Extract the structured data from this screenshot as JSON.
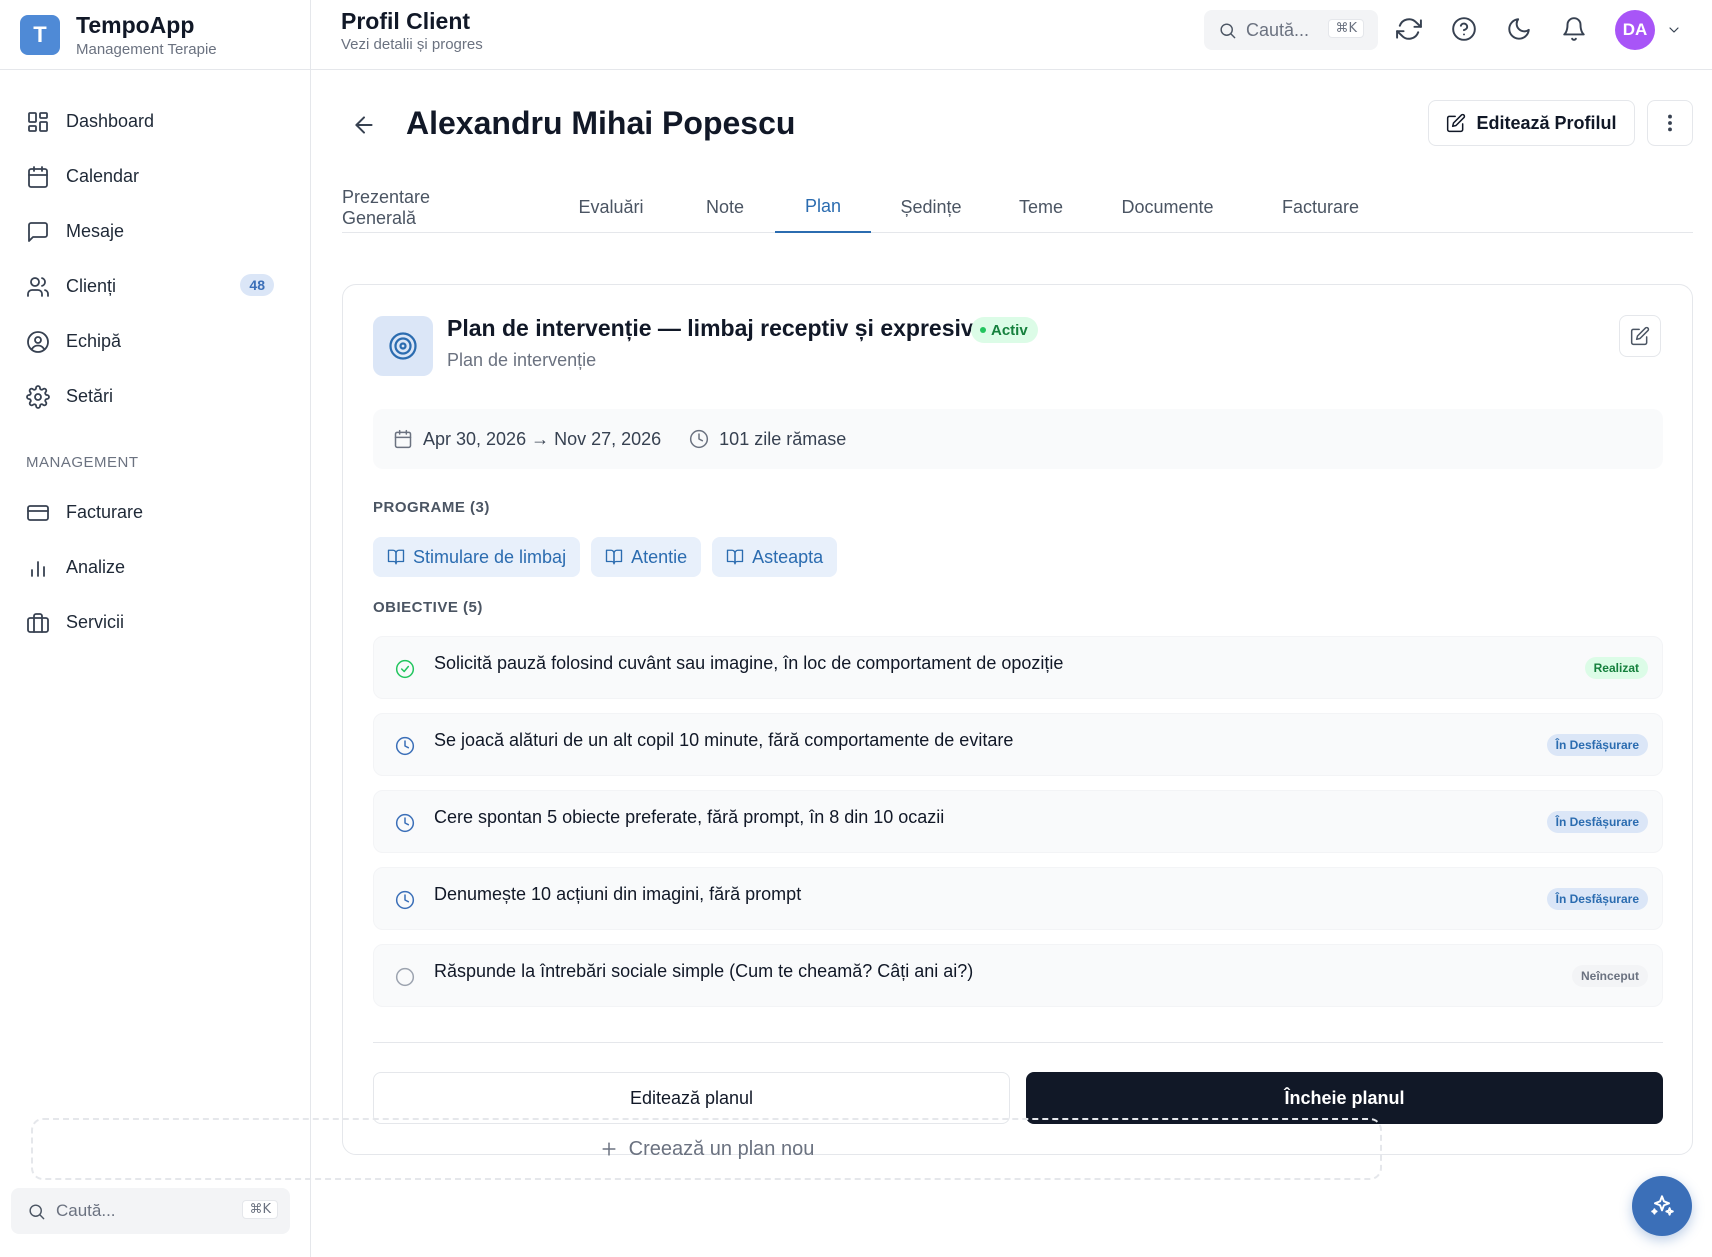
{
  "brand": {
    "logo_letter": "T",
    "name": "TempoApp",
    "subtitle": "Management Terapie"
  },
  "sidebar": {
    "items": [
      {
        "label": "Dashboard",
        "icon": "dashboard-icon"
      },
      {
        "label": "Calendar",
        "icon": "calendar-icon"
      },
      {
        "label": "Mesaje",
        "icon": "message-icon"
      },
      {
        "label": "Clienți",
        "icon": "users-icon",
        "badge": "48"
      },
      {
        "label": "Echipă",
        "icon": "user-circle-icon"
      },
      {
        "label": "Setări",
        "icon": "gear-icon"
      }
    ],
    "section_label": "MANAGEMENT",
    "management_items": [
      {
        "label": "Facturare",
        "icon": "credit-card-icon"
      },
      {
        "label": "Analize",
        "icon": "bar-chart-icon"
      },
      {
        "label": "Servicii",
        "icon": "briefcase-icon"
      }
    ],
    "search": {
      "placeholder": "Caută...",
      "shortcut": "⌘K"
    }
  },
  "header": {
    "title": "Profil Client",
    "subtitle": "Vezi detalii și progres",
    "search": {
      "placeholder": "Caută...",
      "shortcut": "⌘K"
    },
    "avatar_initials": "DA"
  },
  "client": {
    "name": "Alexandru Mihai Popescu",
    "edit_profile_label": "Editează Profilul"
  },
  "tabs": [
    {
      "label": "Prezentare Generală",
      "active": false
    },
    {
      "label": "Evaluări",
      "active": false
    },
    {
      "label": "Note",
      "active": false
    },
    {
      "label": "Plan",
      "active": true
    },
    {
      "label": "Ședințe",
      "active": false
    },
    {
      "label": "Teme",
      "active": false
    },
    {
      "label": "Documente",
      "active": false
    },
    {
      "label": "Facturare",
      "active": false
    }
  ],
  "plan": {
    "title": "Plan de intervenție — limbaj receptiv și expresiv",
    "status": "Activ",
    "subtitle": "Plan de intervenție",
    "date_range": "Apr 30, 2026 → Nov 27, 2026",
    "days_left": "101 zile rămase",
    "programs_label": "PROGRAME (3)",
    "programs": [
      "Stimulare de limbaj",
      "Atentie",
      "Asteapta"
    ],
    "objectives_label": "OBIECTIVE (5)",
    "objectives": [
      {
        "text": "Solicită pauză folosind cuvânt sau imagine, în loc de comportament de opoziție",
        "status": "Realizat",
        "state": "done"
      },
      {
        "text": "Se joacă alături de un alt copil 10 minute, fără comportamente de evitare",
        "status": "În Desfășurare",
        "state": "progress"
      },
      {
        "text": "Cere spontan 5 obiecte preferate, fără prompt, în 8 din 10 ocazii",
        "status": "În Desfășurare",
        "state": "progress"
      },
      {
        "text": "Denumește 10 acțiuni din imagini, fără prompt",
        "status": "În Desfășurare",
        "state": "progress"
      },
      {
        "text": "Răspunde la întrebări sociale simple (Cum te cheamă? Câți ani ai?)",
        "status": "Neînceput",
        "state": "todo"
      }
    ],
    "edit_button": "Editează planul",
    "end_button": "Încheie planul"
  },
  "new_plan_label": "Creează un plan nou",
  "colors": {
    "accent": "#2b6cb0",
    "primary_button": "#111827",
    "avatar": "#a855f7",
    "success": "#15803d"
  }
}
